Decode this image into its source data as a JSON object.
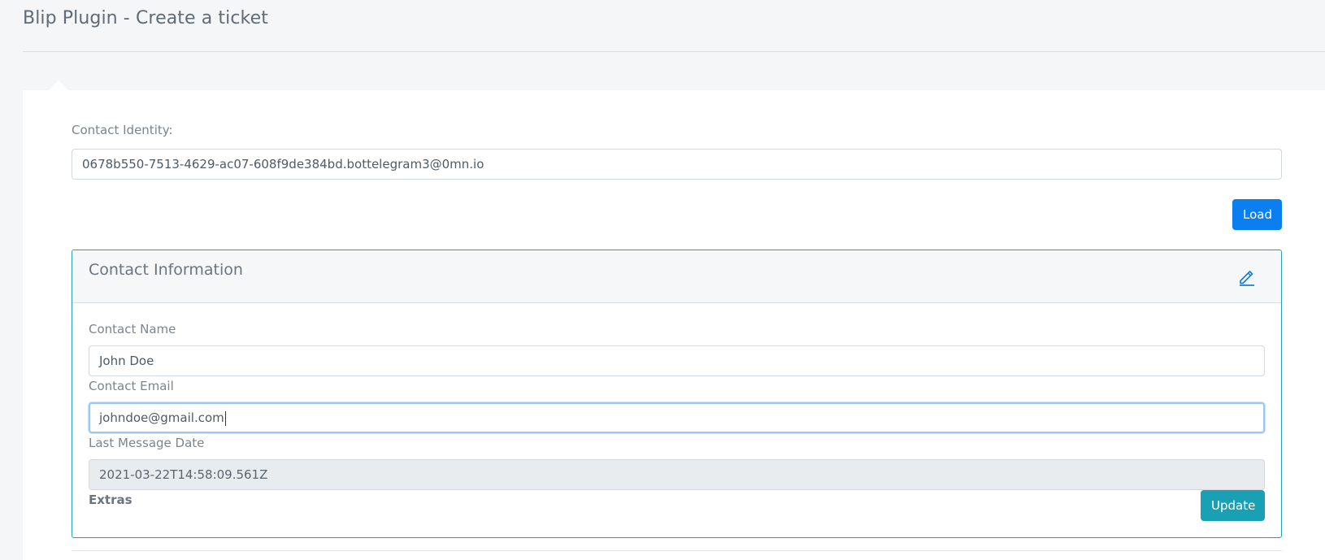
{
  "page": {
    "title": "Blip Plugin - Create a ticket"
  },
  "identity": {
    "label": "Contact Identity:",
    "value": "0678b550-7513-4629-ac07-608f9de384bd.bottelegram3@0mn.io",
    "load_label": "Load"
  },
  "contact_panel": {
    "title": "Contact Information",
    "edit_icon": "pencil-icon",
    "name_label": "Contact Name",
    "name_value": "John Doe",
    "email_label": "Contact Email",
    "email_value": "johndoe@gmail.com",
    "date_label": "Last Message Date",
    "date_value": "2021-03-22T14:58:09.561Z",
    "extras_label": "Extras",
    "update_label": "Update"
  },
  "colors": {
    "primary": "#0b7ef0",
    "info": "#1aa0b4",
    "panel_border": "#2a9db0",
    "focus_ring": "#9cc7f0"
  }
}
